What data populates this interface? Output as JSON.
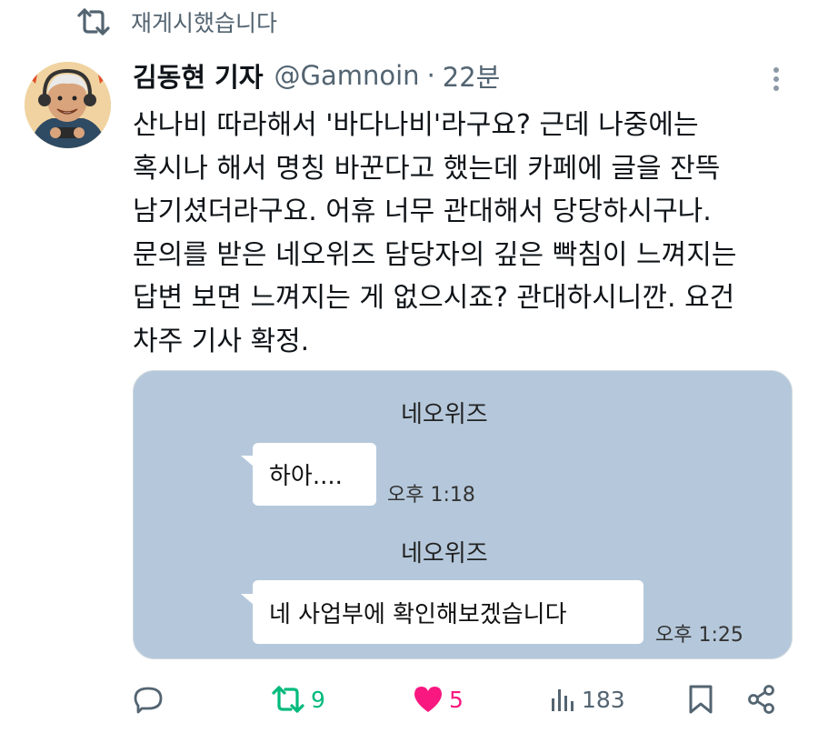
{
  "repost": {
    "label": "재게시했습니다"
  },
  "tweet": {
    "author_name": "김동현 기자",
    "handle": "@Gamnoin",
    "separator": "·",
    "time": "22분",
    "lines": [
      "산나비 따라해서 '바다나비'라구요? 근데 나중에는",
      "혹시나 해서 명칭 바꾼다고 했는데 카페에 글을 잔뜩",
      "남기셨더라구요. 어휴 너무 관대해서 당당하시구나.",
      "문의를 받은 네오위즈 담당자의 깊은 빡침이 느껴지는",
      "답변 보면 느껴지는 게 없으시죠? 관대하시니깐. 요건",
      "차주 기사 확정."
    ]
  },
  "media": {
    "messages": [
      {
        "sender": "네오위즈",
        "text": "하아....",
        "time": "오후 1:18"
      },
      {
        "sender": "네오위즈",
        "text": "네 사업부에 확인해보겠습니다",
        "time": "오후 1:25"
      }
    ]
  },
  "actions": {
    "reply_count": "",
    "repost_count": "9",
    "like_count": "5",
    "views_count": "183"
  },
  "colors": {
    "repost_active": "#00ba7c",
    "like_active": "#f91880",
    "muted": "#536471",
    "chat_bg": "#b5c8db"
  }
}
